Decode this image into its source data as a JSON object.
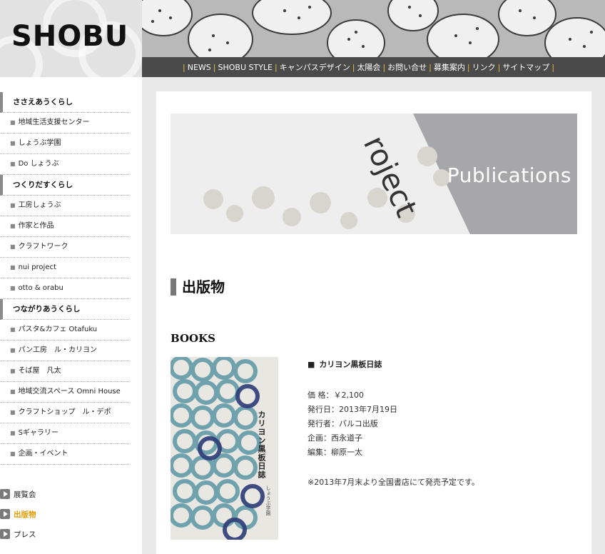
{
  "logo": {
    "text": "SHOBU"
  },
  "nav": {
    "items": [
      "NEWS",
      "SHOBU STYLE",
      "キャンパスデザイン",
      "太陽会",
      "お問い合せ",
      "募集案内",
      "リンク",
      "サイトマップ"
    ]
  },
  "sidebar": {
    "sections": [
      {
        "category": "ささえあうくらし",
        "items": [
          "地域生活支援センター",
          "しょうぶ学園",
          "Do しょうぶ"
        ]
      },
      {
        "category": "つくりだすくらし",
        "items": [
          "工房しょうぶ",
          "作家と作品",
          "クラフトワーク",
          "nui project",
          "otto & orabu"
        ]
      },
      {
        "category": "つながりあうくらし",
        "items": [
          "パスタ&カフェ Otafuku",
          "パン工房　ル・カリヨン",
          "そば屋　凡太",
          "地域交流スペース Omni House",
          "クラフトショップ　ル・デポ",
          "Sギャラリー",
          "企画・イベント"
        ]
      }
    ],
    "extras": [
      {
        "label": "展覧会",
        "active": false
      },
      {
        "label": "出版物",
        "active": true
      },
      {
        "label": "プレス",
        "active": false
      }
    ]
  },
  "banner": {
    "text": "Publications"
  },
  "page": {
    "title": "出版物",
    "section": "BOOKS"
  },
  "book": {
    "cover_title": "カリヨン黒板日誌",
    "cover_publisher": "しょうぶ学園",
    "name": "カリヨン黒板日誌",
    "details": [
      "価 格：￥2,100",
      "発行日：2013年7月19日",
      "発行者：パルコ出版",
      "企画：西永道子",
      "編集：柳原一太"
    ],
    "note": "※2013年7月末より全国書店にて発売予定です。"
  },
  "colors": {
    "nav_bg": "#4a4a4a",
    "nav_separator": "#e0c040",
    "active_menu": "#e29a00",
    "content_bg": "#e9e9e9"
  }
}
